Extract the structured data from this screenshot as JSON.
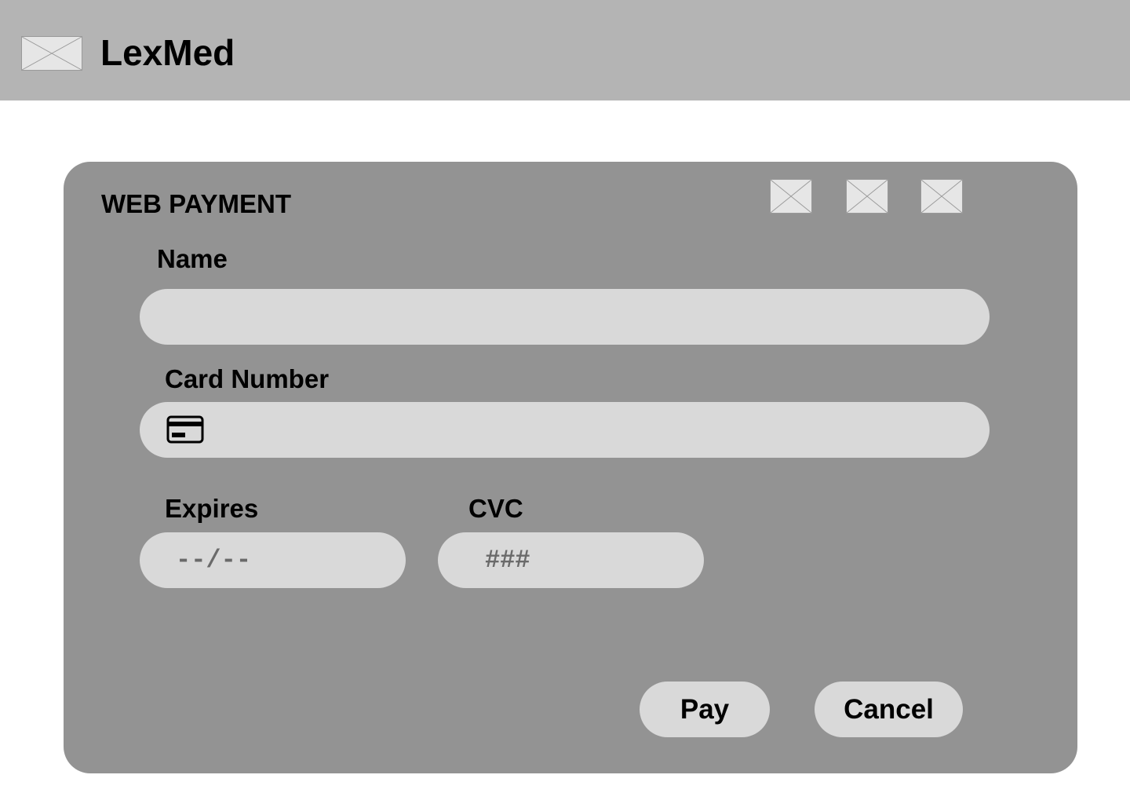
{
  "header": {
    "brand": "LexMed",
    "logo_icon": "image-placeholder-icon"
  },
  "payment": {
    "title": "WEB PAYMENT",
    "card_brand_icons": [
      "image-placeholder-icon",
      "image-placeholder-icon",
      "image-placeholder-icon"
    ],
    "name": {
      "label": "Name",
      "value": "",
      "placeholder": ""
    },
    "card_number": {
      "label": "Card Number",
      "value": "",
      "placeholder": "",
      "icon": "credit-card-icon"
    },
    "expires": {
      "label": "Expires",
      "value": "",
      "placeholder": "--/--"
    },
    "cvc": {
      "label": "CVC",
      "value": "",
      "placeholder": "###"
    },
    "pay_label": "Pay",
    "cancel_label": "Cancel"
  },
  "colors": {
    "header_bg": "#b4b4b4",
    "card_bg": "#939393",
    "field_bg": "#d9d9d9",
    "placeholder_text": "#6a6a6a"
  }
}
